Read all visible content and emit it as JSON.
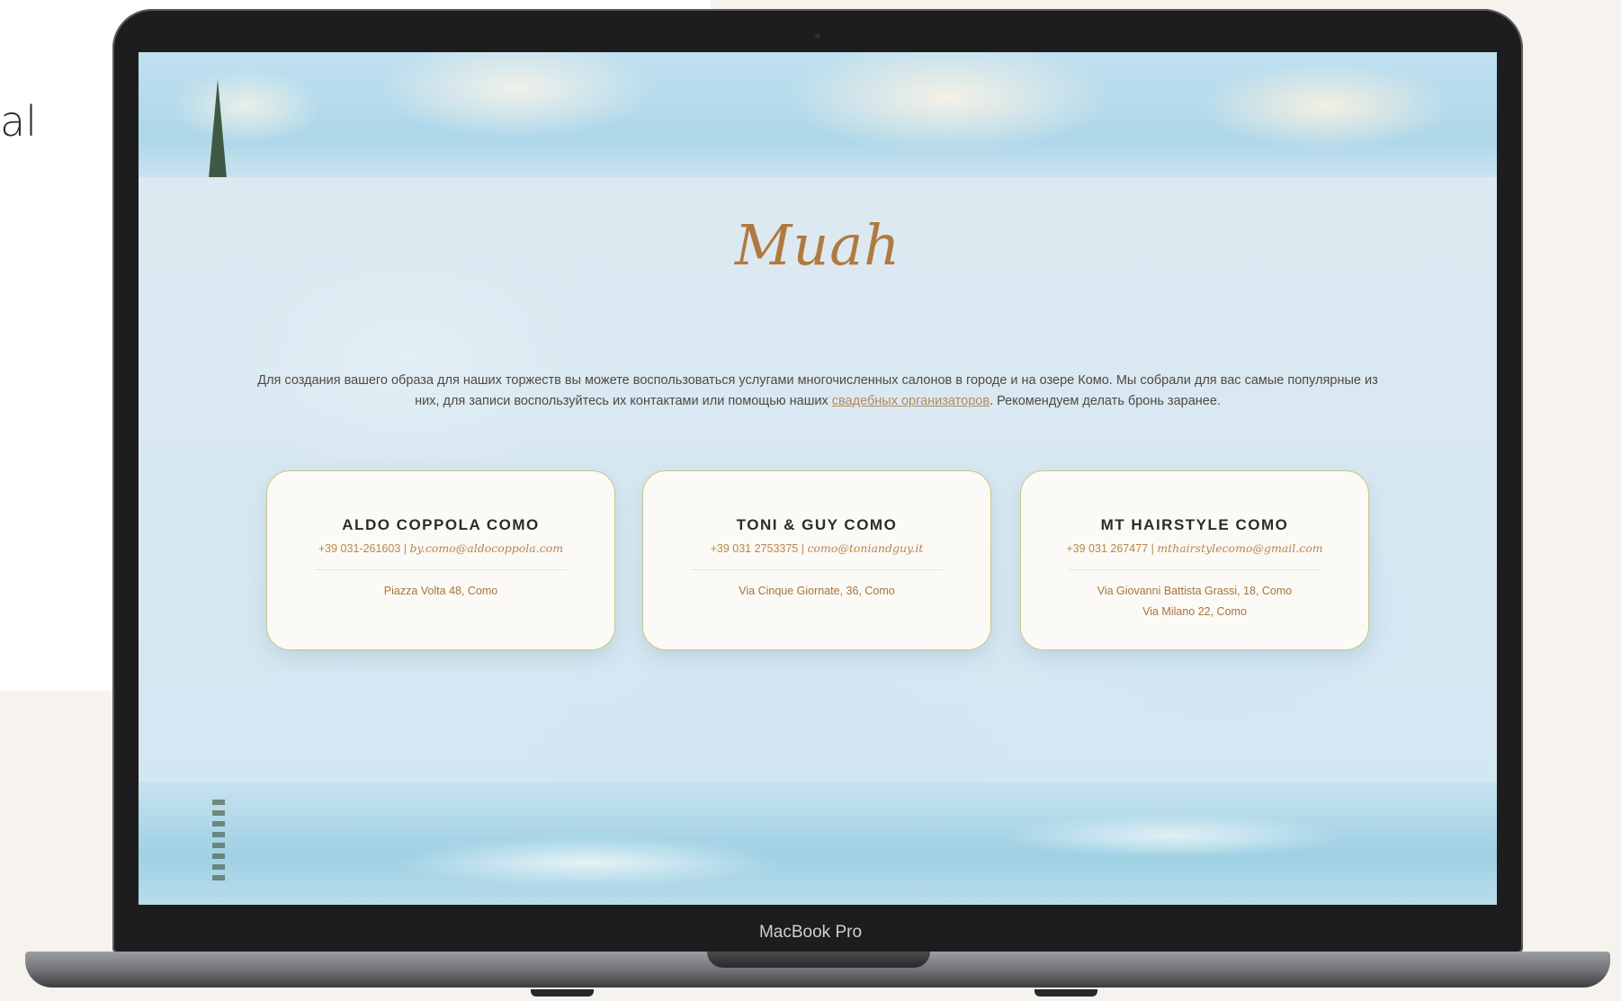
{
  "side_text": "al",
  "device": {
    "model_label": "MacBook Pro"
  },
  "page": {
    "logo": "Muah",
    "intro_before": "Для создания вашего образа для наших торжеств вы можете воспользоваться услугами многочисленных салонов в городе и на озере Комо. Мы собрали для вас самые популярные из них, для записи воспользуйтесь их контактами или помощью наших ",
    "intro_link": "свадебных организаторов",
    "intro_after": ". Рекомендуем делать бронь заранее.",
    "salons": [
      {
        "name": "ALDO COPPOLA COMO",
        "phone": "+39 031-261603",
        "email": "by.como@aldocoppola.com",
        "addresses": [
          "Piazza Volta 48, Como"
        ]
      },
      {
        "name": "TONI & GUY COMO",
        "phone": "+39 031 2753375",
        "email": "como@toniandguy.it",
        "addresses": [
          "Via Cinque Giornate, 36, Como"
        ]
      },
      {
        "name": "MT HAIRSTYLE COMO",
        "phone": "+39 031 267477",
        "email": "mthairstylecomo@gmail.com",
        "addresses": [
          "Via Giovanni Battista Grassi, 18, Como",
          "Via Milano 22, Como"
        ]
      }
    ],
    "separator": " | "
  },
  "colors": {
    "accent_gold": "#b07a3f",
    "card_border": "#c6c88a",
    "card_bg": "#fbfaf6"
  }
}
